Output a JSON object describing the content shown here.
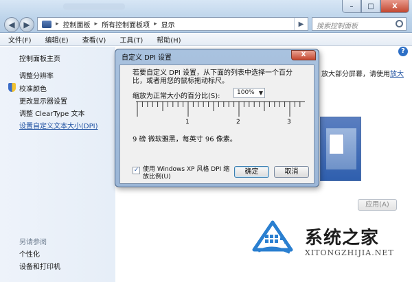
{
  "titlebar": {
    "minimize": "–",
    "maximize": "□",
    "close": "X"
  },
  "nav": {
    "back": "◀",
    "forward": "▶",
    "go": "▶"
  },
  "address": {
    "breadcrumbs": [
      "控制面板",
      "所有控制面板项",
      "显示"
    ],
    "separator": "▸"
  },
  "search": {
    "placeholder": "搜索控制面板"
  },
  "menu": [
    "文件(F)",
    "编辑(E)",
    "查看(V)",
    "工具(T)",
    "帮助(H)"
  ],
  "sidebar": {
    "home": "控制面板主页",
    "items": [
      "调整分辨率",
      "校准颜色",
      "更改显示器设置",
      "调整 ClearType 文本",
      "设置自定义文本大小(DPI)"
    ],
    "see_also_title": "另请参阅",
    "see_also": [
      "个性化",
      "设备和打印机"
    ]
  },
  "content": {
    "help": "?",
    "partial_text": "放大部分屏幕，请使用",
    "partial_link": "放大",
    "apply": "应用(A)"
  },
  "dialog": {
    "title": "自定义 DPI 设置",
    "close": "X",
    "description": "若要自定义 DPI 设置，从下面的列表中选择一个百分比，或者用您的鼠标拖动标尺。",
    "scale_label": "缩放为正常大小的百分比(S):",
    "scale_value": "100%",
    "ruler_numbers": [
      "1",
      "2",
      "3"
    ],
    "font_info": "9 磅 微软雅黑，每英寸 96 像素。",
    "xp_checkbox_label": "使用 Windows XP 风格 DPI 缩放比例(U)",
    "xp_checked": true,
    "ok": "确定",
    "cancel": "取消"
  },
  "watermark": {
    "brand": "系统之家",
    "site": "XITONGZHIJIA.NET",
    "colors": {
      "accent": "#2a7fd0"
    }
  }
}
